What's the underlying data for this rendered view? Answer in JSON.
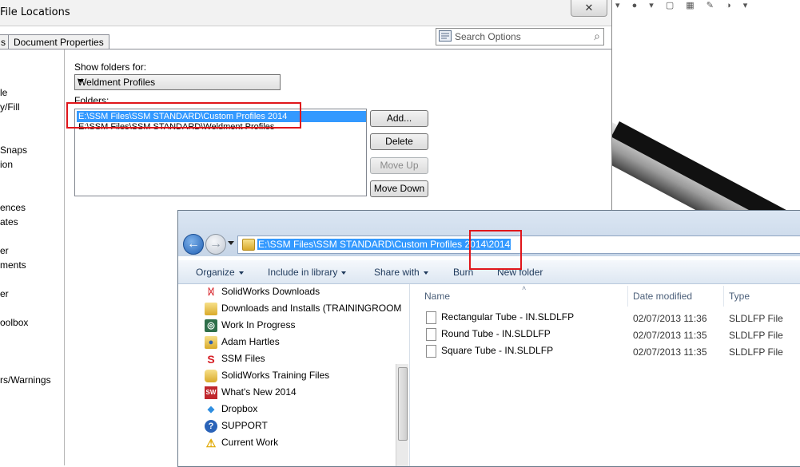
{
  "dialog": {
    "title": "File Locations",
    "tabs": [
      "s",
      "Document Properties"
    ],
    "search_placeholder": "Search Options",
    "left_pane_items": [
      "le",
      "y/Fill",
      "Snaps",
      "ion",
      "ences",
      "ates",
      "er",
      "ments",
      "er",
      "oolbox",
      "rs/Warnings"
    ],
    "show_folders_label": "Show folders for:",
    "show_folders_value": "Weldment Profiles",
    "folders_label": "Folders:",
    "folders": [
      "E:\\SSM Files\\SSM STANDARD\\Custom Profiles 2014",
      "E:\\SSM Files\\SSM STANDARD\\Weldment Profiles"
    ],
    "buttons": {
      "add": "Add...",
      "delete": "Delete",
      "move_up": "Move Up",
      "move_down": "Move Down"
    }
  },
  "explorer": {
    "address": "E:\\SSM Files\\SSM STANDARD\\Custom Profiles 2014\\2014",
    "commands": [
      "Organize",
      "Include in library",
      "Share with",
      "Burn",
      "New folder"
    ],
    "nav_items": [
      {
        "label": "SolidWorks Downloads",
        "icon": "solidworks-icon"
      },
      {
        "label": "Downloads and Installs (TRAININGROOM",
        "icon": "folder-icon"
      },
      {
        "label": "Work In Progress",
        "icon": "network-folder-icon"
      },
      {
        "label": "Adam Hartles",
        "icon": "folder-icon"
      },
      {
        "label": "SSM Files",
        "icon": "ssm-icon"
      },
      {
        "label": "SolidWorks Training Files",
        "icon": "folder-group-icon"
      },
      {
        "label": "What's New 2014",
        "icon": "whats-new-icon"
      },
      {
        "label": "Dropbox",
        "icon": "dropbox-icon"
      },
      {
        "label": "SUPPORT",
        "icon": "help-icon"
      },
      {
        "label": "Current Work",
        "icon": "warning-icon"
      }
    ],
    "columns": [
      "Name",
      "Date modified",
      "Type"
    ],
    "files": [
      {
        "name": "Rectangular Tube - IN.SLDLFP",
        "date": "02/07/2013 11:36",
        "type": "SLDLFP File"
      },
      {
        "name": "Round Tube - IN.SLDLFP",
        "date": "02/07/2013 11:35",
        "type": "SLDLFP File"
      },
      {
        "name": "Square Tube - IN.SLDLFP",
        "date": "02/07/2013 11:35",
        "type": "SLDLFP File"
      }
    ]
  }
}
